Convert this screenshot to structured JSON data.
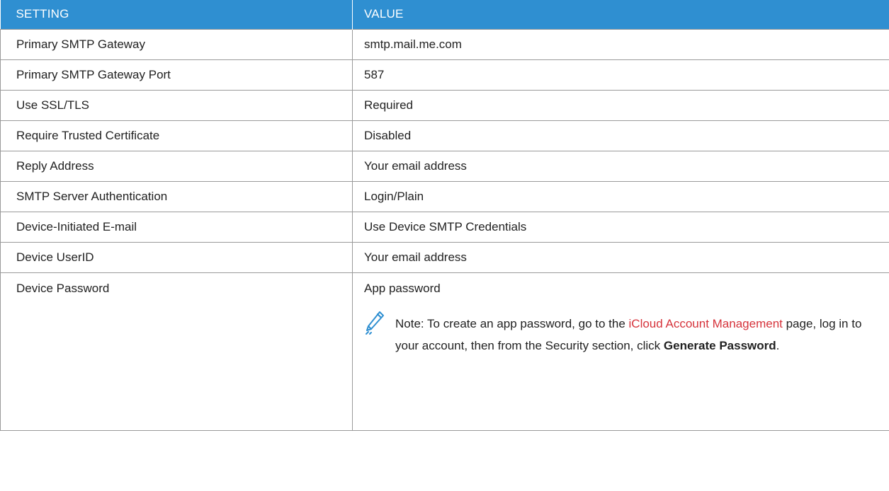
{
  "table": {
    "header": {
      "setting": "SETTING",
      "value": "VALUE"
    },
    "rows": [
      {
        "setting": "Primary SMTP Gateway",
        "value": "smtp.mail.me.com"
      },
      {
        "setting": "Primary SMTP Gateway Port",
        "value": "587"
      },
      {
        "setting": "Use SSL/TLS",
        "value": "Required"
      },
      {
        "setting": "Require Trusted Certificate",
        "value": "Disabled"
      },
      {
        "setting": "Reply Address",
        "value": "Your email address"
      },
      {
        "setting": "SMTP Server Authentication",
        "value": "Login/Plain"
      },
      {
        "setting": "Device-Initiated E-mail",
        "value": "Use Device SMTP Credentials"
      },
      {
        "setting": "Device UserID",
        "value": "Your email address"
      },
      {
        "setting": "Device Password",
        "value": "App password"
      }
    ],
    "note": {
      "icon": "pencil-note-icon",
      "prefix": "Note: To create an app password, go to the ",
      "link": "iCloud Account Management",
      "middle": " page, log in to your account, then from the Security section, click ",
      "bold": "Generate Password",
      "suffix": "."
    }
  },
  "colors": {
    "header_bg": "#2f8fd1",
    "header_text": "#ffffff",
    "border": "#9a9a9a",
    "link": "#d6333b",
    "icon": "#2f8fd1"
  }
}
